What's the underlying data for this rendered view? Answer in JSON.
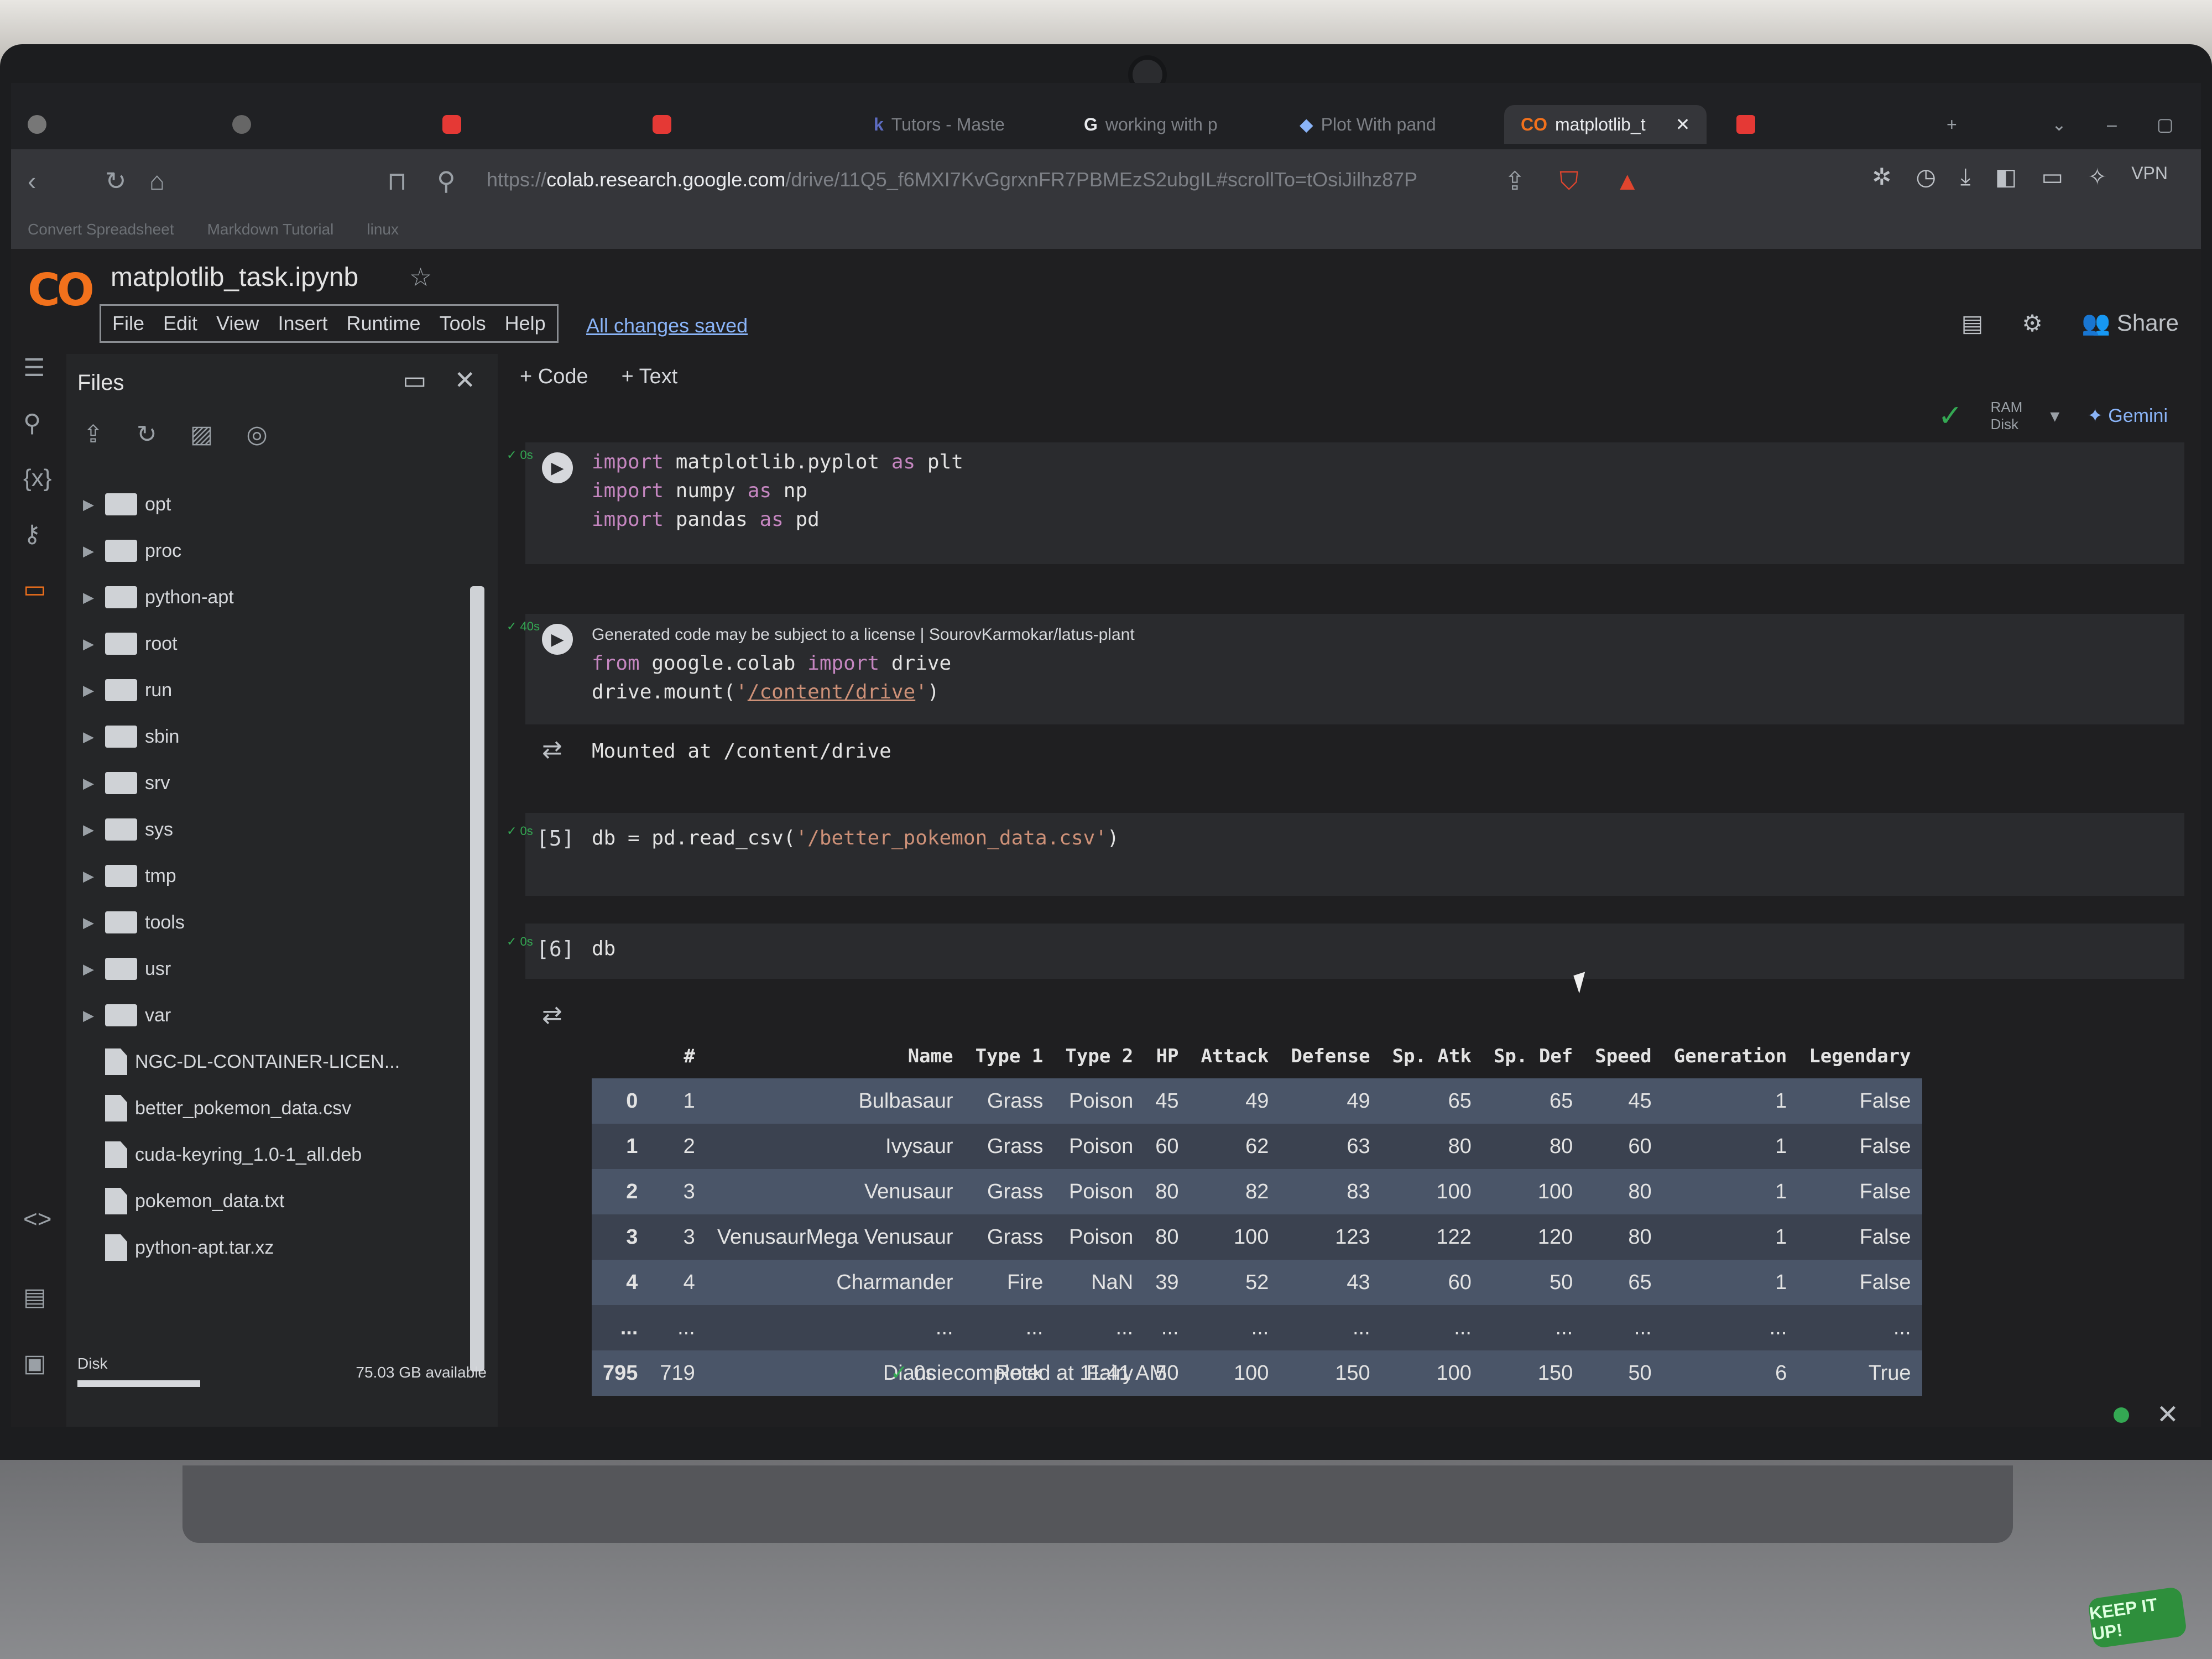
{
  "browser": {
    "tabs": [
      {
        "label": "",
        "icon": "youtube-icon"
      },
      {
        "label": "",
        "icon": "youtube-icon"
      },
      {
        "label": "Tutors - Maste",
        "icon": "k-icon"
      },
      {
        "label": "working with p",
        "icon": "google-icon"
      },
      {
        "label": "Plot With pand",
        "icon": "python-icon"
      },
      {
        "label": "matplotlib_t",
        "icon": "colab-icon",
        "active": true
      },
      {
        "label": "",
        "icon": "brave-icon"
      }
    ],
    "url_prefix": "https://",
    "url_domain": "colab.research.google.com",
    "url_path": "/drive/11Q5_f6MXI7KvGgrxnFR7PBMEzS2ubgIL#scrollTo=tOsiJilhz87P",
    "bookmarks": [
      "Convert Spreadsheet",
      "Markdown Tutorial",
      "linux"
    ],
    "vpn_label": "VPN"
  },
  "colab": {
    "notebook_title": "matplotlib_task.ipynb",
    "menu": [
      "File",
      "Edit",
      "View",
      "Insert",
      "Runtime",
      "Tools",
      "Help"
    ],
    "save_status": "All changes saved",
    "share_label": "Share",
    "insert_code": "+ Code",
    "insert_text": "+ Text",
    "ram_label": "RAM",
    "disk_label": "Disk",
    "gemini_label": "Gemini"
  },
  "sidebar": {
    "title": "Files",
    "folders": [
      "opt",
      "proc",
      "python-apt",
      "root",
      "run",
      "sbin",
      "srv",
      "sys",
      "tmp",
      "tools",
      "usr",
      "var"
    ],
    "files": [
      "NGC-DL-CONTAINER-LICEN...",
      "better_pokemon_data.csv",
      "cuda-keyring_1.0-1_all.deb",
      "pokemon_data.txt",
      "python-apt.tar.xz"
    ],
    "disk_label": "Disk",
    "disk_available": "75.03 GB available",
    "disk_used_fraction": 0.3
  },
  "cells": {
    "c1": {
      "exec_time": "0s"
    },
    "c2": {
      "exec_time": "40s",
      "license_note": "Generated code may be subject to a license | SourovKarmokar/latus-plant",
      "output": "Mounted at /content/drive"
    },
    "c3": {
      "number": "[5]",
      "exec_time": "0s"
    },
    "c4": {
      "number": "[6]",
      "exec_time": "0s",
      "code": "db"
    }
  },
  "dataframe": {
    "columns": [
      "",
      "#",
      "Name",
      "Type 1",
      "Type 2",
      "HP",
      "Attack",
      "Defense",
      "Sp. Atk",
      "Sp. Def",
      "Speed",
      "Generation",
      "Legendary"
    ],
    "rows": [
      [
        "0",
        "1",
        "Bulbasaur",
        "Grass",
        "Poison",
        "45",
        "49",
        "49",
        "65",
        "65",
        "45",
        "1",
        "False"
      ],
      [
        "1",
        "2",
        "Ivysaur",
        "Grass",
        "Poison",
        "60",
        "62",
        "63",
        "80",
        "80",
        "60",
        "1",
        "False"
      ],
      [
        "2",
        "3",
        "Venusaur",
        "Grass",
        "Poison",
        "80",
        "82",
        "83",
        "100",
        "100",
        "80",
        "1",
        "False"
      ],
      [
        "3",
        "3",
        "VenusaurMega Venusaur",
        "Grass",
        "Poison",
        "80",
        "100",
        "123",
        "122",
        "120",
        "80",
        "1",
        "False"
      ],
      [
        "4",
        "4",
        "Charmander",
        "Fire",
        "NaN",
        "39",
        "52",
        "43",
        "60",
        "50",
        "65",
        "1",
        "False"
      ],
      [
        "...",
        "...",
        "...",
        "...",
        "...",
        "...",
        "...",
        "...",
        "...",
        "...",
        "...",
        "...",
        "..."
      ],
      [
        "795",
        "719",
        "Diancie",
        "Rock",
        "Fairy",
        "50",
        "100",
        "150",
        "100",
        "150",
        "50",
        "6",
        "True"
      ]
    ]
  },
  "footer": {
    "exec_time": "0s",
    "completed": "completed at 11:41 AM"
  },
  "sticker_text": "KEEP IT UP!"
}
